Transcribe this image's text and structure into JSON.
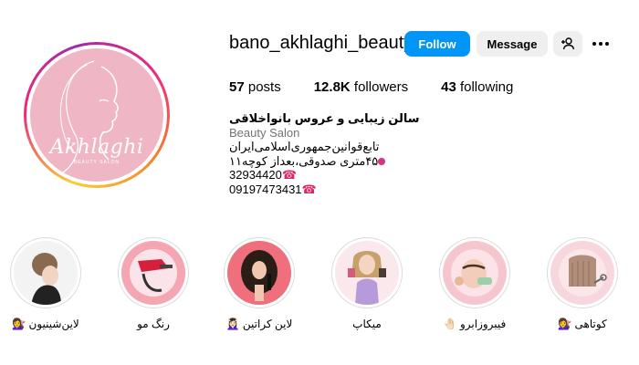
{
  "profile": {
    "username": "bano_akhlaghi_beauty",
    "avatar_brand": "Akhlaghi",
    "avatar_sub": "BEAUTY SALON",
    "actions": {
      "follow_label": "Follow",
      "message_label": "Message",
      "suggest_icon": "person-plus-icon",
      "more_icon": "more-horizontal-icon"
    },
    "stats": {
      "posts_value": "57",
      "posts_label": "posts",
      "followers_value": "12.8K",
      "followers_label": "followers",
      "following_value": "43",
      "following_label": "following"
    },
    "bio": {
      "fullname": "سالن زیبایی و عروس بانواخلاقی",
      "category": "Beauty Salon",
      "line1": "تابع‌قوانین‌جمهوری‌اسلامی‌ایران",
      "line2": "۴۵متری صدوقی،بعداز کوچه۱۱",
      "phone1": "32934420",
      "phone2": "09197473431"
    }
  },
  "highlights": [
    {
      "label": "لاین‌شینیون 💇‍♀️"
    },
    {
      "label": "رنگ مو"
    },
    {
      "label": "لاین کراتین 💆🏻‍♀️"
    },
    {
      "label": "میکاپ"
    },
    {
      "label": "فیبروزابرو 🤚🏻"
    },
    {
      "label": "کوتاهی 💇‍♀️"
    }
  ],
  "colors": {
    "accent": "#0095f6",
    "avatar_bg": "#efb6c5",
    "button_gray": "#efefef",
    "category_gray": "#737373"
  }
}
